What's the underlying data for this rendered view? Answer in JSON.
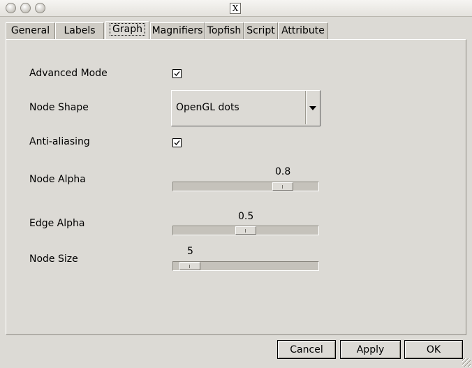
{
  "window": {
    "title_icon": "x-window-icon"
  },
  "tabs": [
    {
      "label": "General",
      "active": false
    },
    {
      "label": "Labels",
      "active": false
    },
    {
      "label": "Graph",
      "active": true
    },
    {
      "label": "Magnifiers",
      "active": false
    },
    {
      "label": "Topfish",
      "active": false
    },
    {
      "label": "Script",
      "active": false
    },
    {
      "label": "Attribute",
      "active": false
    }
  ],
  "graph": {
    "advanced_mode": {
      "label": "Advanced Mode",
      "checked": true
    },
    "node_shape": {
      "label": "Node Shape",
      "value": "OpenGL dots"
    },
    "anti_aliasing": {
      "label": "Anti-aliasing",
      "checked": true
    },
    "node_alpha": {
      "label": "Node Alpha",
      "value": "0.8",
      "fraction": 0.8
    },
    "edge_alpha": {
      "label": "Edge Alpha",
      "value": "0.5",
      "fraction": 0.5
    },
    "node_size": {
      "label": "Node Size",
      "value": "5",
      "fraction": 0.05
    }
  },
  "buttons": {
    "cancel": "Cancel",
    "apply": "Apply",
    "ok": "OK"
  },
  "colors": {
    "background": "#dcdad5",
    "track": "#c5c2bb"
  }
}
